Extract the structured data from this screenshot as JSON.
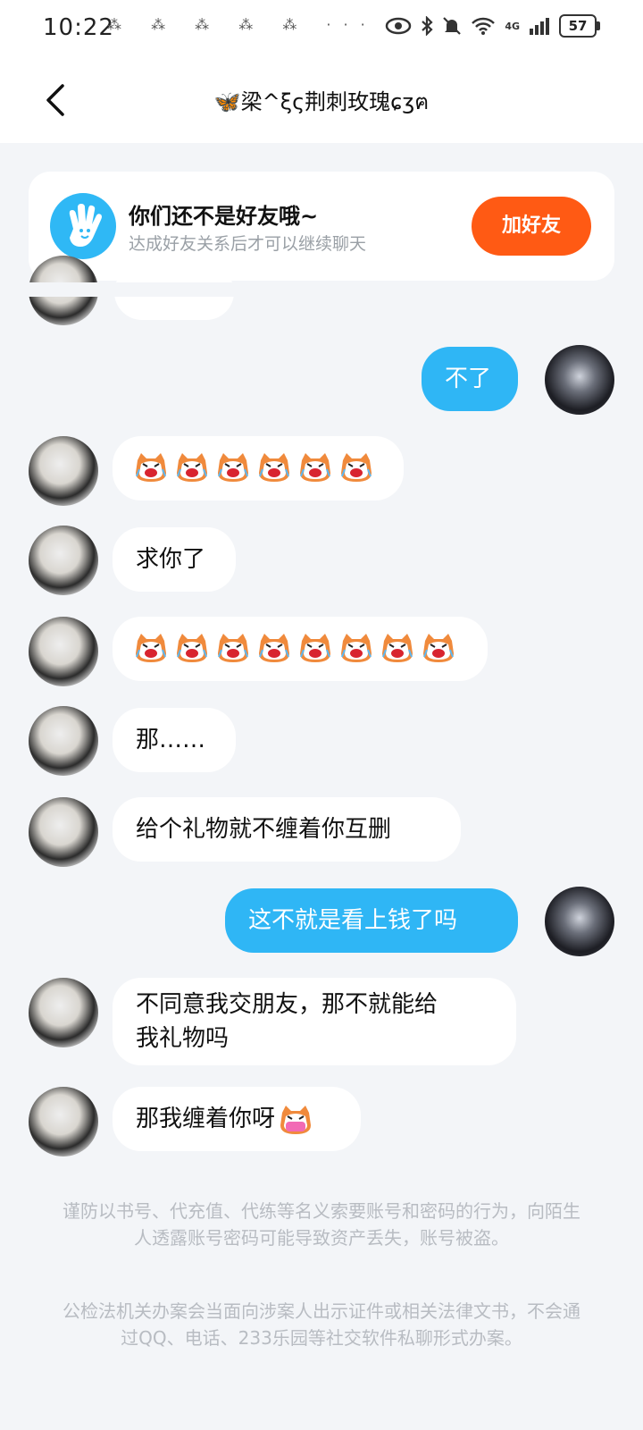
{
  "status_bar": {
    "time": "10:22",
    "notification_icons": "⁂ ⁂ ⁂ ⁂ ⁂ ···",
    "network_label": "4G",
    "battery": "57"
  },
  "header": {
    "title": "🦋梁^ξς荆刺玫瑰ɕʒฅ"
  },
  "friend_banner": {
    "title": "你们还不是好友哦~",
    "subtitle": "达成好友关系后才可以继续聊天",
    "button": "加好友"
  },
  "messages": [
    {
      "from": "self",
      "text": "不了"
    },
    {
      "from": "other",
      "emoji": "crying-cat",
      "count": 6
    },
    {
      "from": "other",
      "text": "求你了"
    },
    {
      "from": "other",
      "emoji": "crying-cat",
      "count": 8
    },
    {
      "from": "other",
      "text": "那……"
    },
    {
      "from": "other",
      "text": "给个礼物就不缠着你互删"
    },
    {
      "from": "self",
      "text": "这不就是看上钱了吗"
    },
    {
      "from": "other",
      "text_line1": "不同意我交朋友，那不就能给",
      "text_line2": "我礼物吗"
    },
    {
      "from": "other",
      "text": "那我缠着你呀"
    }
  ],
  "notices": [
    "谨防以书号、代充值、代练等名义索要账号和密码的行为，向陌生人透露账号密码可能导致资产丢失，账号被盗。",
    "公检法机关办案会当面向涉案人出示证件或相关法律文书，不会通过QQ、电话、233乐园等社交软件私聊形式办案。"
  ],
  "colors": {
    "accent_blue": "#2fb6f5",
    "add_button": "#ff5a14",
    "background": "#f3f5f8"
  }
}
